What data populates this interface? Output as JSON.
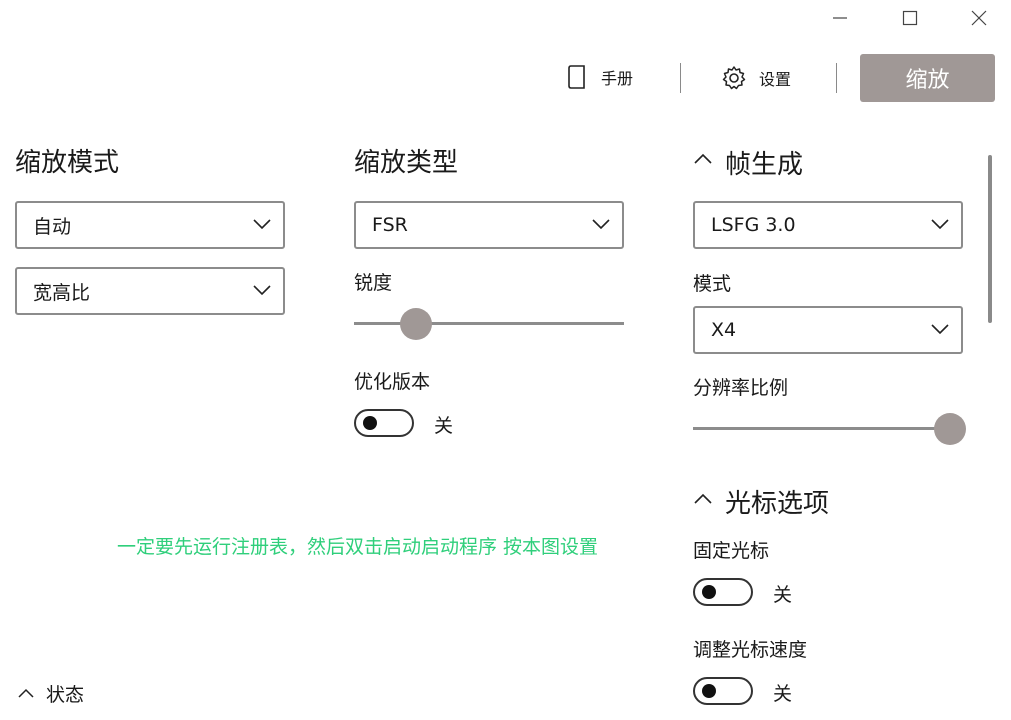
{
  "toolbar": {
    "manual_label": "手册",
    "settings_label": "设置",
    "scale_button": "缩放"
  },
  "scaling_mode": {
    "title": "缩放模式",
    "mode_value": "自动",
    "aspect_value": "宽高比"
  },
  "scaling_type": {
    "title": "缩放类型",
    "type_value": "FSR",
    "sharpness_label": "锐度",
    "sharpness_level": 0.23,
    "optimized_label": "优化版本",
    "optimized_state": "关"
  },
  "frame_gen": {
    "title": "帧生成",
    "engine_value": "LSFG 3.0",
    "mode_label": "模式",
    "mode_value": "X4",
    "resolution_label": "分辨率比例",
    "resolution_level": 0.95
  },
  "cursor_options": {
    "title": "光标选项",
    "fixed_label": "固定光标",
    "fixed_state": "关",
    "speed_label": "调整光标速度",
    "speed_state": "关"
  },
  "note_text": "一定要先运行注册表，然后双击启动启动程序 按本图设置",
  "status_label": "状态",
  "colors": {
    "accent": "#a09896",
    "note": "#2fcf7b",
    "border": "#8c8c8c"
  },
  "icons": [
    "minimize-icon",
    "maximize-icon",
    "close-icon",
    "book-icon",
    "gear-icon",
    "chevron-down-icon",
    "chevron-up-icon"
  ]
}
